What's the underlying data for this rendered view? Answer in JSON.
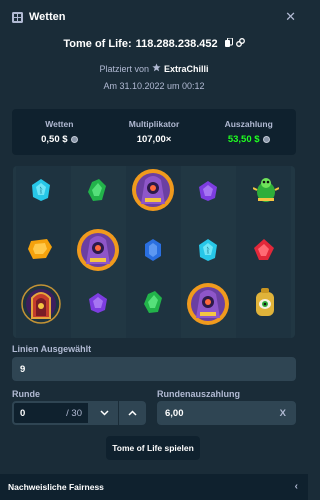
{
  "header": {
    "title": "Wetten"
  },
  "bet": {
    "game": "Tome of Life",
    "separator": ":",
    "id": "118.288.238.452",
    "placed_by_label": "Platziert von",
    "user": "ExtraChilli",
    "date": "Am 31.10.2022 um 00:12"
  },
  "stats": [
    {
      "label": "Wetten",
      "value": "0,50 $"
    },
    {
      "label": "Multiplikator",
      "value": "107,00×"
    },
    {
      "label": "Auszahlung",
      "value": "53,50 $"
    }
  ],
  "board": {
    "columns": 5,
    "rows": 3,
    "symbols": [
      [
        "cyan-gem-icon",
        "orange-gem-icon",
        "portal-scatter-icon"
      ],
      [
        "green-gem-icon",
        "pharaoh-wild-icon",
        "purple-gem-icon"
      ],
      [
        "pharaoh-wild-icon",
        "blue-gem-icon",
        "green-gem-icon"
      ],
      [
        "purple-gem-icon",
        "cyan-gem-icon",
        "pharaoh-wild-icon"
      ],
      [
        "green-beetle-icon",
        "red-gem-icon",
        "eye-amulet-icon"
      ]
    ]
  },
  "form": {
    "lines_label": "Linien Ausgewählt",
    "lines_value": "9",
    "round_label": "Runde",
    "round_value": "0",
    "round_max": "/ 30",
    "payout_label": "Rundenauszahlung",
    "payout_value": "6,00",
    "payout_suffix": "X",
    "play_button": "Tome of Life spielen"
  },
  "footer": {
    "label": "Nachweisliche Fairness"
  },
  "colors": {
    "bg": "#1a2c38",
    "panel": "#0f212e",
    "input": "#2f4553",
    "green": "#1fff20",
    "muted": "#b1bad3"
  }
}
